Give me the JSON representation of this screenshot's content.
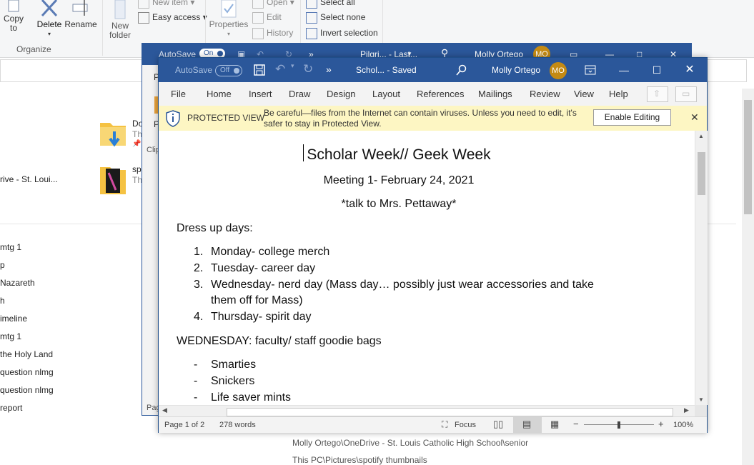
{
  "explorer": {
    "ribbon": {
      "copy_to": "Copy\nto",
      "delete": "Delete",
      "rename": "Rename",
      "new_folder": "New\nfolder",
      "new_item": "New item",
      "easy_access": "Easy access",
      "properties": "Properties",
      "open": "Open",
      "edit": "Edit",
      "history": "History",
      "select_all": "Select all",
      "select_none": "Select none",
      "invert_selection": "Invert selection",
      "organize": "Organize"
    },
    "nav_items": [
      "rive - St. Loui...",
      "mtg 1",
      "p",
      "Nazareth",
      "h",
      "imeline",
      "mtg 1",
      "the Holy Land",
      "question nlmg",
      "question nlmg",
      "report"
    ],
    "files": [
      {
        "name": "Do",
        "sub": "Th"
      },
      {
        "name": "sp",
        "sub": "Th"
      }
    ],
    "path_line": "Molly Ortego\\OneDrive - St. Louis Catholic High School\\senior",
    "path_line2": "This PC\\Pictures\\spotify thumbnails"
  },
  "word_back": {
    "autosave": "AutoSave",
    "toggle": "On",
    "title": "Pilgri... - Last...",
    "user": "Molly Ortego",
    "initials": "MO",
    "side_p": "P",
    "side_clip": "Clip",
    "side_pag": "Pag"
  },
  "word": {
    "autosave": "AutoSave",
    "toggle": "Off",
    "doc_title": "Schol... - Saved",
    "user": "Molly Ortego",
    "initials": "MO",
    "tabs": [
      "File",
      "Home",
      "Insert",
      "Draw",
      "Design",
      "Layout",
      "References",
      "Mailings",
      "Review",
      "View",
      "Help"
    ],
    "protected": {
      "title": "PROTECTED VIEW",
      "message": "Be careful—files from the Internet can contain viruses. Unless you need to edit, it's safer to stay in Protected View.",
      "button": "Enable Editing"
    },
    "status": {
      "page": "Page 1 of 2",
      "words": "278 words",
      "focus": "Focus",
      "zoom": "100%",
      "zoom_level": 0.5
    },
    "document": {
      "title": "Scholar Week// Geek Week",
      "meeting": "Meeting 1- February 24, 2021",
      "note": "*talk to Mrs. Pettaway*",
      "dress_heading": "Dress up days:",
      "dress_items": [
        {
          "num": "1.",
          "text": "Monday- college merch"
        },
        {
          "num": "2.",
          "text": "Tuesday- career day"
        },
        {
          "num": "3.",
          "text": "Wednesday- nerd day (Mass day… possibly just wear accessories and take"
        },
        {
          "num": "",
          "text": "them off for Mass)"
        },
        {
          "num": "4.",
          "text": "Thursday- spirit day"
        }
      ],
      "wed_heading": "WEDNESDAY: faculty/ staff goodie bags",
      "goodie_items": [
        {
          "bullet": "-",
          "text": "Smarties"
        },
        {
          "bullet": "-",
          "text": "Snickers"
        },
        {
          "bullet": "-",
          "text": "Life saver mints"
        }
      ]
    }
  }
}
